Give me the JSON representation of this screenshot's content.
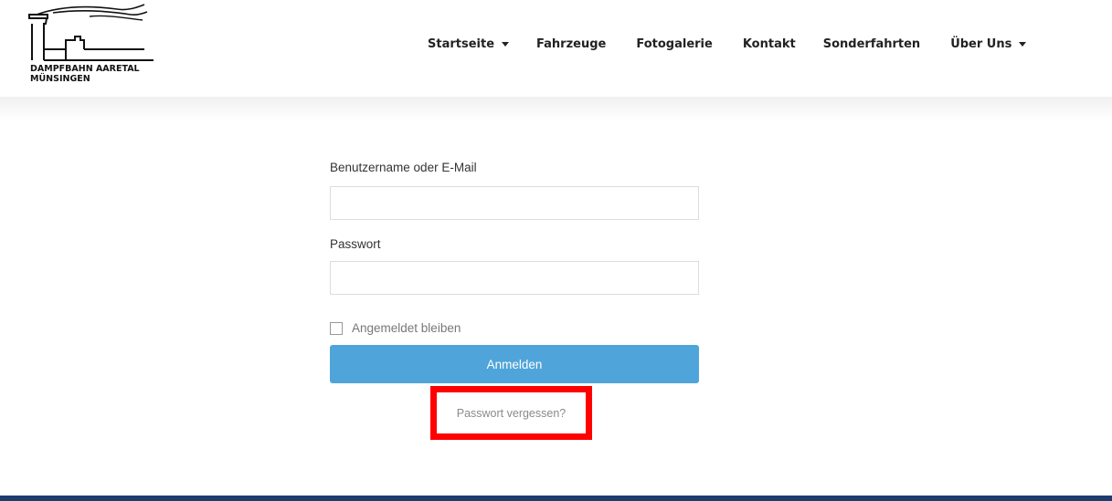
{
  "brand": {
    "line1": "DAMPFBAHN AARETAL",
    "line2": "MÜNSINGEN"
  },
  "nav": {
    "items": [
      {
        "label": "Startseite",
        "has_dropdown": true
      },
      {
        "label": "Fahrzeuge",
        "has_dropdown": false
      },
      {
        "label": "Fotogalerie",
        "has_dropdown": false
      },
      {
        "label": "Kontakt",
        "has_dropdown": false
      },
      {
        "label": "Sonderfahrten",
        "has_dropdown": false
      },
      {
        "label": "Über Uns",
        "has_dropdown": true
      }
    ]
  },
  "login": {
    "username_label": "Benutzername oder E-Mail",
    "username_value": "",
    "password_label": "Passwort",
    "password_value": "",
    "remember_label": "Angemeldet bleiben",
    "remember_checked": false,
    "submit_label": "Anmelden",
    "forgot_label": "Passwort vergessen?"
  },
  "colors": {
    "button": "#4fa4d9",
    "highlight": "#ff0000",
    "footer": "#1c3d6e"
  }
}
